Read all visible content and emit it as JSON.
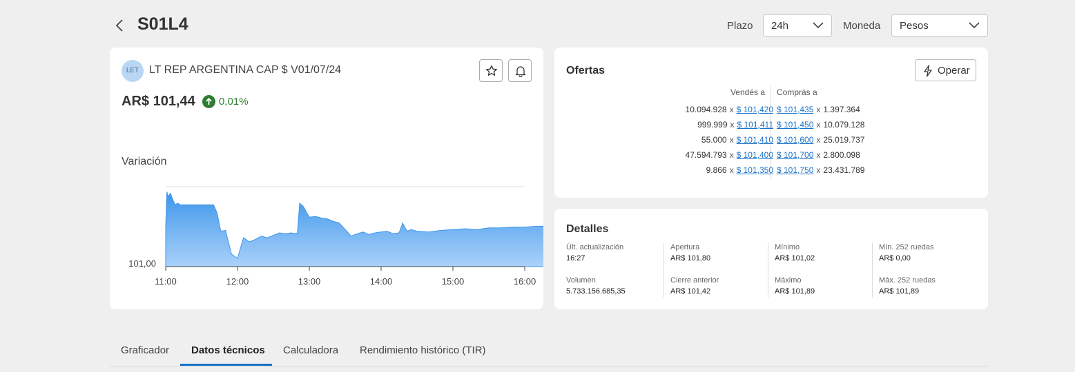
{
  "header": {
    "ticker": "S01L4",
    "plazo_label": "Plazo",
    "plazo_value": "24h",
    "moneda_label": "Moneda",
    "moneda_value": "Pesos"
  },
  "instrument": {
    "badge": "LET",
    "name": "LT REP ARGENTINA CAP $ V01/07/24",
    "price": "AR$ 101,44",
    "change": "0,01%",
    "change_color": "#2e7d32",
    "variation_label": "Variación"
  },
  "chart_data": {
    "type": "area",
    "title": "",
    "xlabel": "",
    "ylabel": "",
    "x_ticks": [
      "11:00",
      "12:00",
      "13:00",
      "14:00",
      "15:00",
      "16:00"
    ],
    "y_ticks": [
      "101,00"
    ],
    "color": "#4da3ee",
    "x": [
      "11:00",
      "11:01",
      "11:02",
      "11:04",
      "11:06",
      "11:08",
      "11:10",
      "11:12",
      "11:15",
      "11:20",
      "11:25",
      "11:30",
      "11:35",
      "11:40",
      "11:43",
      "11:46",
      "11:50",
      "11:55",
      "12:00",
      "12:05",
      "12:10",
      "12:15",
      "12:20",
      "12:25",
      "12:30",
      "12:35",
      "12:40",
      "12:45",
      "12:48",
      "12:50",
      "12:52",
      "12:55",
      "13:00",
      "13:05",
      "13:10",
      "13:15",
      "13:20",
      "13:25",
      "13:30",
      "13:35",
      "13:40",
      "13:45",
      "13:50",
      "13:55",
      "14:00",
      "14:05",
      "14:10",
      "14:15",
      "14:18",
      "14:20",
      "14:22",
      "14:25",
      "14:30",
      "14:40",
      "14:50",
      "15:00",
      "15:10",
      "15:20",
      "15:30",
      "15:40",
      "15:50",
      "16:00",
      "16:10",
      "16:20"
    ],
    "values": [
      101.45,
      101.86,
      101.8,
      101.84,
      101.76,
      101.7,
      101.72,
      101.7,
      101.7,
      101.7,
      101.7,
      101.7,
      101.7,
      101.7,
      101.6,
      101.38,
      101.39,
      101.1,
      101.05,
      101.3,
      101.25,
      101.28,
      101.32,
      101.3,
      101.33,
      101.36,
      101.35,
      101.36,
      101.35,
      101.36,
      101.72,
      101.68,
      101.55,
      101.56,
      101.54,
      101.53,
      101.5,
      101.48,
      101.4,
      101.32,
      101.35,
      101.37,
      101.34,
      101.36,
      101.37,
      101.38,
      101.35,
      101.36,
      101.48,
      101.42,
      101.38,
      101.4,
      101.38,
      101.37,
      101.39,
      101.4,
      101.41,
      101.4,
      101.42,
      101.42,
      101.43,
      101.43,
      101.44,
      101.44
    ]
  },
  "ofertas": {
    "title": "Ofertas",
    "operar_label": "Operar",
    "sell_header": "Vendés a",
    "buy_header": "Comprás a",
    "sells": [
      {
        "qty": "10.094.928",
        "price": "$ 101,420"
      },
      {
        "qty": "999.999",
        "price": "$ 101,411"
      },
      {
        "qty": "55.000",
        "price": "$ 101,410"
      },
      {
        "qty": "47.594.793",
        "price": "$ 101,400"
      },
      {
        "qty": "9.866",
        "price": "$ 101,350"
      }
    ],
    "buys": [
      {
        "price": "$ 101,435",
        "qty": "1.397.364"
      },
      {
        "price": "$ 101,450",
        "qty": "10.079.128"
      },
      {
        "price": "$ 101,600",
        "qty": "25.019.737"
      },
      {
        "price": "$ 101,700",
        "qty": "2.800.098"
      },
      {
        "price": "$ 101,750",
        "qty": "23.431.789"
      }
    ],
    "times": "x"
  },
  "detalles": {
    "title": "Detalles",
    "items": [
      {
        "label": "Últ. actualización",
        "value": "16:27"
      },
      {
        "label": "Apertura",
        "value": "AR$ 101,80"
      },
      {
        "label": "Mínimo",
        "value": "AR$ 101,02"
      },
      {
        "label": "Mín. 252 ruedas",
        "value": "AR$ 0,00"
      },
      {
        "label": "Volumen",
        "value": "5.733.156.685,35"
      },
      {
        "label": "Cierre anterior",
        "value": "AR$ 101,42"
      },
      {
        "label": "Máximo",
        "value": "AR$ 101,89"
      },
      {
        "label": "Máx. 252 ruedas",
        "value": "AR$ 101,89"
      }
    ]
  },
  "tabs": [
    {
      "label": "Graficador",
      "active": false
    },
    {
      "label": "Datos técnicos",
      "active": true
    },
    {
      "label": "Calculadora",
      "active": false
    },
    {
      "label": "Rendimiento histórico (TIR)",
      "active": false
    }
  ]
}
